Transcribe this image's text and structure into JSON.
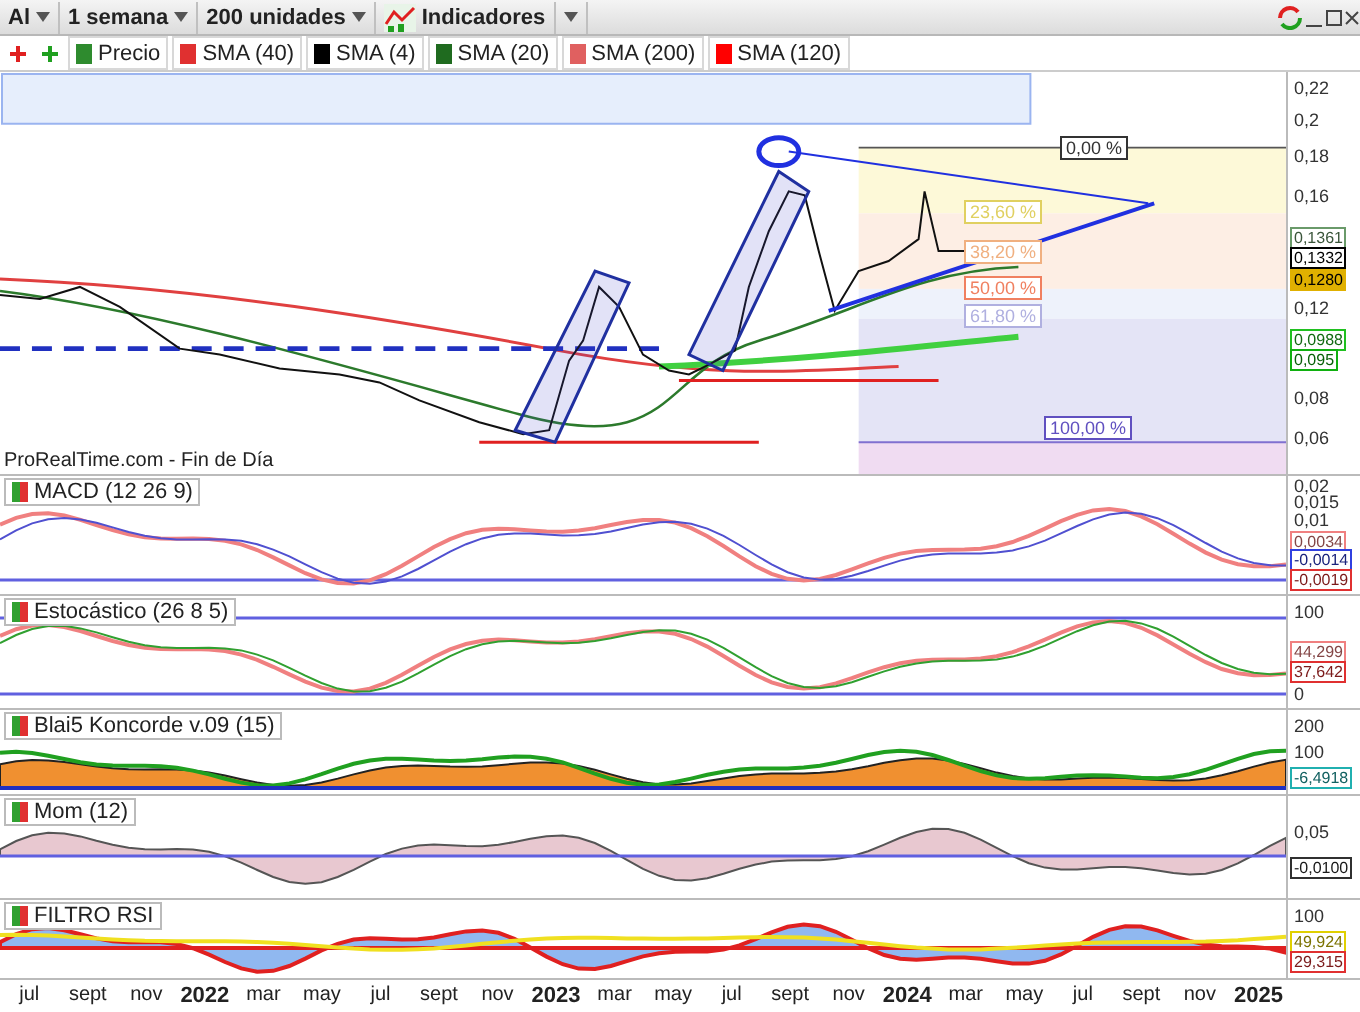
{
  "toolbar": {
    "instrument": "Al",
    "period": "1 semana",
    "units": "200 unidades",
    "indicators": "Indicadores"
  },
  "legend": [
    {
      "label": "Precio",
      "color": "#2e8b2e"
    },
    {
      "label": "SMA (40)",
      "color": "#e03030"
    },
    {
      "label": "SMA (4)",
      "color": "#000000"
    },
    {
      "label": "SMA (20)",
      "color": "#1f6b1f"
    },
    {
      "label": "SMA (200)",
      "color": "#e06060"
    },
    {
      "label": "SMA (120)",
      "color": "#ff0000"
    }
  ],
  "main": {
    "source": "ProRealTime.com - Fin de Día",
    "ticks": [
      "0,22",
      "0,2",
      "0,18",
      "0,16",
      "0,12",
      "0,08",
      "0,06"
    ],
    "fib_levels": [
      "0,00 %",
      "23,60 %",
      "38,20 %",
      "50,00 %",
      "61,80 %",
      "100,00 %"
    ],
    "values": [
      {
        "text": "0,1361",
        "color": "#6a9a6a"
      },
      {
        "text": "0,1332",
        "color": "#000000"
      },
      {
        "text": "0,1280",
        "color": "#e0b000"
      },
      {
        "text": "0,0988",
        "color": "#20c020"
      },
      {
        "text": "0,095",
        "color": "#10b010"
      }
    ]
  },
  "panels": [
    {
      "kind": "macd",
      "title": "MACD (12 26 9)",
      "ticks": [
        "0,02",
        "0,015",
        "0,01"
      ],
      "values": [
        {
          "text": "0,0034",
          "color": "#f08080"
        },
        {
          "text": "-0,0014",
          "color": "#3040e0"
        },
        {
          "text": "-0,0019",
          "color": "#e03030"
        }
      ]
    },
    {
      "kind": "stochastic",
      "title": "Estocástico (26 8 5)",
      "ticks": [
        "100",
        "0"
      ],
      "values": [
        {
          "text": "44,299",
          "color": "#f08080"
        },
        {
          "text": "37,642",
          "color": "#e03030"
        }
      ]
    },
    {
      "kind": "koncorde",
      "title": "Blai5 Koncorde v.09 (15)",
      "ticks": [
        "200",
        "100"
      ],
      "values": [
        {
          "text": "-6,4918",
          "color": "#20b0b0"
        }
      ]
    },
    {
      "kind": "momentum",
      "title": "Mom (12)",
      "ticks": [
        "0,05"
      ],
      "values": [
        {
          "text": "-0,0100",
          "color": "#303030"
        }
      ]
    },
    {
      "kind": "rsi",
      "title": "FILTRO RSI",
      "ticks": [
        "100"
      ],
      "values": [
        {
          "text": "49,924",
          "color": "#e0d000"
        },
        {
          "text": "29,315",
          "color": "#e03030"
        }
      ]
    }
  ],
  "x_axis": [
    {
      "text": "jul",
      "year": false
    },
    {
      "text": "sept",
      "year": false
    },
    {
      "text": "nov",
      "year": false
    },
    {
      "text": "2022",
      "year": true
    },
    {
      "text": "mar",
      "year": false
    },
    {
      "text": "may",
      "year": false
    },
    {
      "text": "jul",
      "year": false
    },
    {
      "text": "sept",
      "year": false
    },
    {
      "text": "nov",
      "year": false
    },
    {
      "text": "2023",
      "year": true
    },
    {
      "text": "mar",
      "year": false
    },
    {
      "text": "may",
      "year": false
    },
    {
      "text": "jul",
      "year": false
    },
    {
      "text": "sept",
      "year": false
    },
    {
      "text": "nov",
      "year": false
    },
    {
      "text": "2024",
      "year": true
    },
    {
      "text": "mar",
      "year": false
    },
    {
      "text": "may",
      "year": false
    },
    {
      "text": "jul",
      "year": false
    },
    {
      "text": "sept",
      "year": false
    },
    {
      "text": "nov",
      "year": false
    },
    {
      "text": "2025",
      "year": true
    }
  ]
}
